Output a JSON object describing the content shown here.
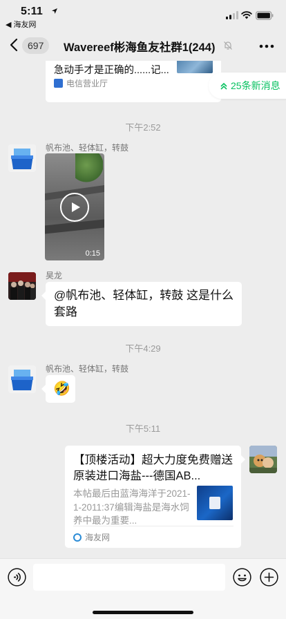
{
  "status_bar": {
    "time": "5:11",
    "back_app": "◀ 海友网"
  },
  "nav": {
    "unread_count": "697",
    "title": "Wavereef彬海鱼友社群1(244)"
  },
  "top_card": {
    "text": "急动手才是正确的......记...",
    "source": "电信营业厅"
  },
  "new_messages": {
    "label": "25条新消息"
  },
  "timestamps": [
    "下午2:52",
    "下午4:29",
    "下午5:11"
  ],
  "messages": [
    {
      "sender": "帆布池、轻体缸，转鼓",
      "type": "video",
      "duration": "0:15"
    },
    {
      "sender": "昊龙",
      "type": "text",
      "text": "@帆布池、轻体缸，转鼓 这是什么套路"
    },
    {
      "sender": "帆布池、轻体缸，转鼓",
      "type": "emoji",
      "emoji": "🤣"
    },
    {
      "type": "link",
      "title": "【顶楼活动】超大力度免费赠送原装进口海盐---德国AB...",
      "desc": "本帖最后由蓝海海洋于2021-1-2011:37编辑海盐是海水饲养中最为重要...",
      "source": "海友网"
    }
  ],
  "colors": {
    "accent": "#07c160",
    "background": "#ededed",
    "bubble": "#ffffff"
  }
}
